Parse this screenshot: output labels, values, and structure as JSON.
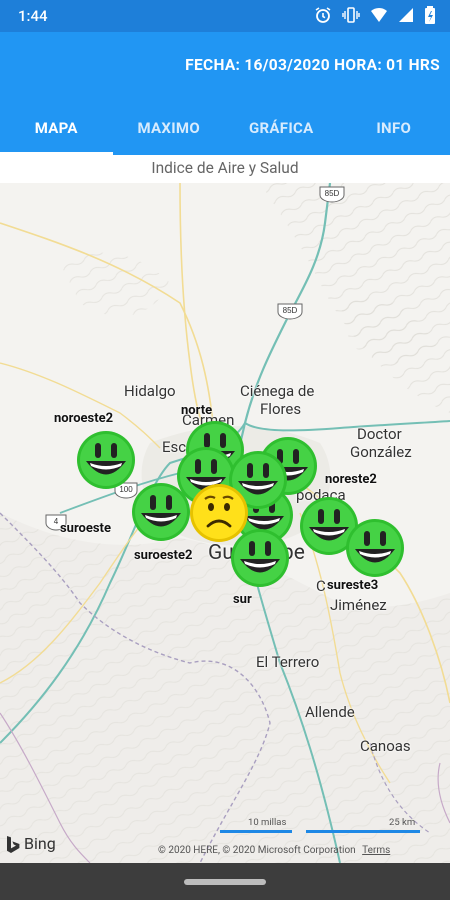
{
  "status_bar": {
    "time": "1:44"
  },
  "header": {
    "date_text": "FECHA: 16/03/2020 HORA: 01 HRS"
  },
  "tabs": [
    {
      "label": "MAPA",
      "active": true
    },
    {
      "label": "MAXIMO",
      "active": false
    },
    {
      "label": "GRÁFICA",
      "active": false
    },
    {
      "label": "INFO",
      "active": false
    }
  ],
  "subtitle": "Indice de Aire y Salud",
  "map": {
    "places": {
      "hidalgo": "Hidalgo",
      "cienega": "Ciénega de",
      "flores": "Flores",
      "doctor": "Doctor",
      "gonzalez": "González",
      "escobedo": "Esc",
      "carmen": "Carmen",
      "apodaca": "podaca",
      "guadalupe": "Gu       upe",
      "cjimenez": "C",
      "jimenez": "Jiménez",
      "terrero": "El Terrero",
      "allende": "Allende",
      "canoas": "Canoas"
    },
    "shields": {
      "r85d": "85D",
      "r85d2": "85D",
      "r100": "100",
      "r4": "4"
    },
    "stations": {
      "noroeste2": "noroeste2",
      "norte": "norte",
      "noreste2": "noreste2",
      "suroeste": "suroeste",
      "suroeste2": "suroeste2",
      "sur": "sur",
      "sureste3": "sureste3"
    },
    "scale_miles": "10 millas",
    "scale_km": "25 km",
    "attribution_brand": "Bing",
    "copyright": "© 2020 HERE, © 2020 Microsoft Corporation",
    "terms": "Terms",
    "good_color": "#33cc33",
    "moderate_color": "#ffdf00"
  }
}
